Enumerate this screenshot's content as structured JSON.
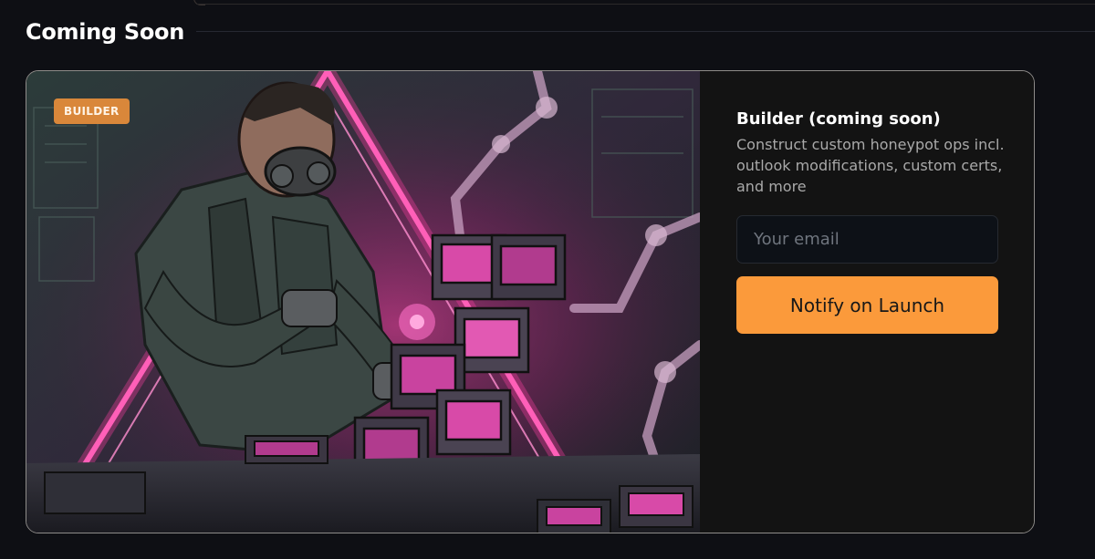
{
  "section": {
    "title": "Coming Soon"
  },
  "card": {
    "badge": "BUILDER",
    "title": "Builder (coming soon)",
    "description": "Construct custom honeypot ops incl. outlook modifications, custom certs, and more",
    "email_placeholder": "Your email",
    "button_label": "Notify on Launch"
  },
  "colors": {
    "background": "#0e0f14",
    "accent": "#fb9a3b",
    "badge": "#d9873a",
    "neon": "#ff3fa4"
  }
}
